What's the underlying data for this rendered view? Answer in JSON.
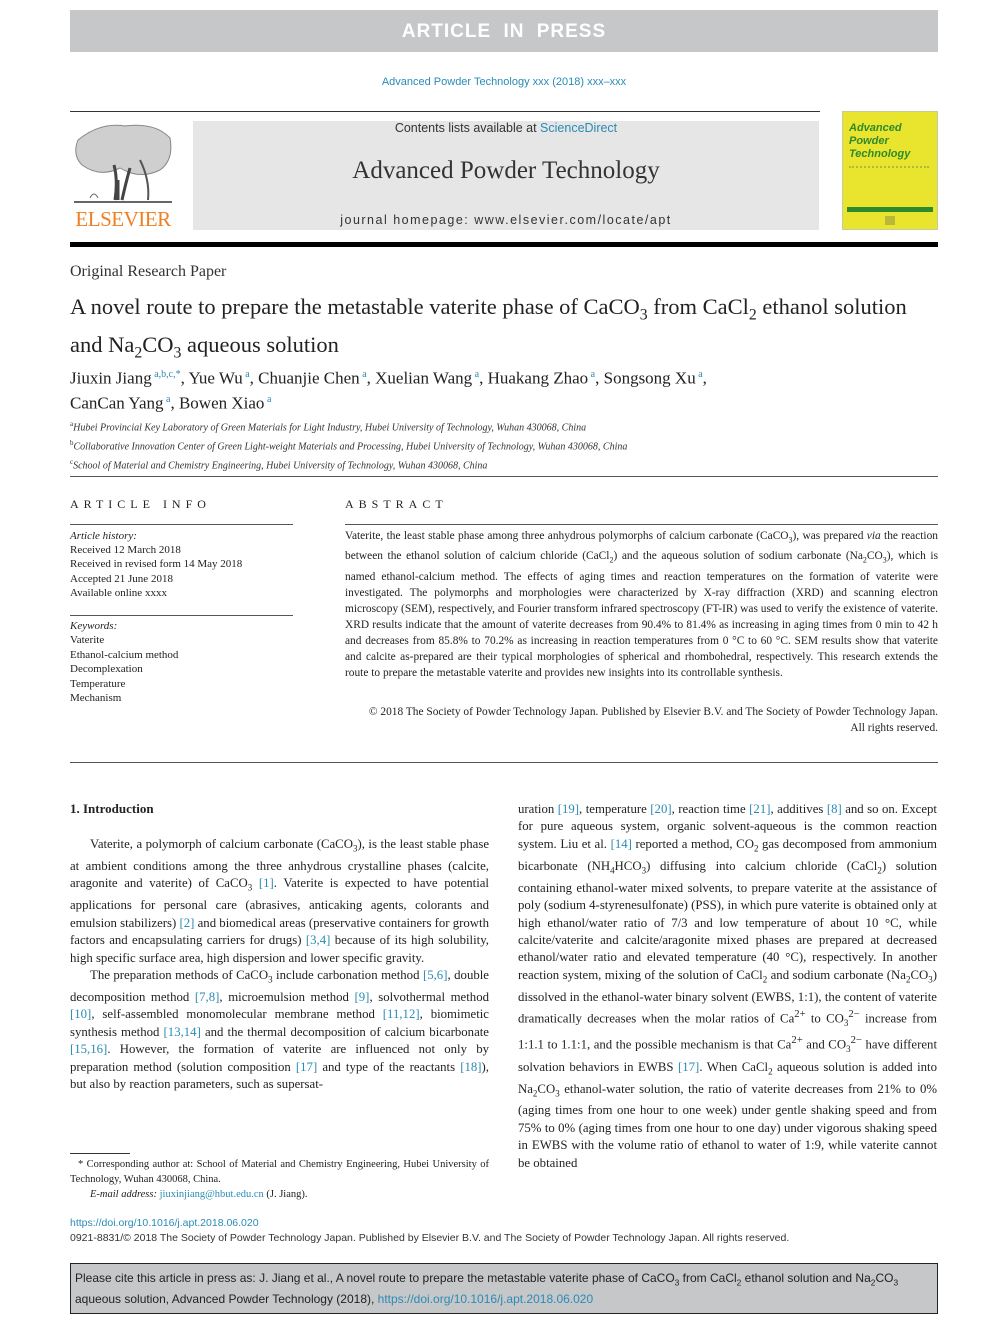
{
  "banner": "ARTICLE IN PRESS",
  "journal_citation": "Advanced Powder Technology xxx (2018) xxx–xxx",
  "header": {
    "publisher_logo_text": "ELSEVIER",
    "contents_prefix": "Contents lists available at ",
    "contents_link": "ScienceDirect",
    "journal_title": "Advanced Powder Technology",
    "homepage": "journal homepage: www.elsevier.com/locate/apt",
    "cover_title": "Advanced Powder Technology"
  },
  "article": {
    "type": "Original Research Paper",
    "title_html": "A novel route to prepare the metastable vaterite phase of CaCO<sub>3</sub> from CaCl<sub>2</sub> ethanol solution and Na<sub>2</sub>CO<sub>3</sub> aqueous solution",
    "authors": [
      {
        "name": "Jiuxin Jiang",
        "marks": "a,b,c,*"
      },
      {
        "name": "Yue Wu",
        "marks": "a"
      },
      {
        "name": "Chuanjie Chen",
        "marks": "a"
      },
      {
        "name": "Xuelian Wang",
        "marks": "a"
      },
      {
        "name": "Huakang Zhao",
        "marks": "a"
      },
      {
        "name": "Songsong Xu",
        "marks": "a"
      },
      {
        "name": "CanCan Yang",
        "marks": "a"
      },
      {
        "name": "Bowen Xiao",
        "marks": "a"
      }
    ],
    "affiliations": [
      {
        "mark": "a",
        "text": "Hubei Provincial Key Laboratory of Green Materials for Light Industry, Hubei University of Technology, Wuhan 430068, China"
      },
      {
        "mark": "b",
        "text": "Collaborative Innovation Center of Green Light-weight Materials and Processing, Hubei University of Technology, Wuhan 430068, China"
      },
      {
        "mark": "c",
        "text": "School of Material and Chemistry Engineering, Hubei University of Technology, Wuhan 430068, China"
      }
    ]
  },
  "article_info": {
    "heading": "ARTICLE INFO",
    "history_label": "Article history:",
    "history": [
      "Received 12 March 2018",
      "Received in revised form 14 May 2018",
      "Accepted 21 June 2018",
      "Available online xxxx"
    ],
    "keywords_label": "Keywords:",
    "keywords": [
      "Vaterite",
      "Ethanol-calcium method",
      "Decomplexation",
      "Temperature",
      "Mechanism"
    ]
  },
  "abstract": {
    "heading": "ABSTRACT",
    "text_html": "Vaterite, the least stable phase among three anhydrous polymorphs of calcium carbonate (CaCO<sub>3</sub>), was prepared <i>via</i> the reaction between the ethanol solution of calcium chloride (CaCl<sub>2</sub>) and the aqueous solution of sodium carbonate (Na<sub>2</sub>CO<sub>3</sub>), which is named ethanol-calcium method. The effects of aging times and reaction temperatures on the formation of vaterite were investigated. The polymorphs and morphologies were characterized by X-ray diffraction (XRD) and scanning electron microscopy (SEM), respectively, and Fourier transform infrared spectroscopy (FT-IR) was used to verify the existence of vaterite. XRD results indicate that the amount of vaterite decreases from 90.4% to 81.4% as increasing in aging times from 0 min to 42 h and decreases from 85.8% to 70.2% as increasing in reaction temperatures from 0 °C to 60 °C. SEM results show that vaterite and calcite as-prepared are their typical morphologies of spherical and rhombohedral, respectively. This research extends the route to prepare the metastable vaterite and provides new insights into its controllable synthesis.",
    "copyright": "© 2018 The Society of Powder Technology Japan. Published by Elsevier B.V. and The Society of Powder Technology Japan. All rights reserved."
  },
  "body": {
    "section_heading": "1. Introduction",
    "left_paragraphs_html": [
      "Vaterite, a polymorph of calcium carbonate (CaCO<sub>3</sub>), is the least stable phase at ambient conditions among the three anhydrous crystalline phases (calcite, aragonite and vaterite) of CaCO<sub>3</sub> <span class=\"link\">[1]</span>. Vaterite is expected to have potential applications for personal care (abrasives, anticaking agents, colorants and emulsion stabilizers) <span class=\"link\">[2]</span> and biomedical areas (preservative containers for growth factors and encapsulating carriers for drugs) <span class=\"link\">[3,4]</span> because of its high solubility, high specific surface area, high dispersion and lower specific gravity.",
      "The preparation methods of CaCO<sub>3</sub> include carbonation method <span class=\"link\">[5,6]</span>, double decomposition method <span class=\"link\">[7,8]</span>, microemulsion method <span class=\"link\">[9]</span>, solvothermal method <span class=\"link\">[10]</span>, self-assembled monomolecular membrane method <span class=\"link\">[11,12]</span>, biomimetic synthesis method <span class=\"link\">[13,14]</span> and the thermal decomposition of calcium bicarbonate <span class=\"link\">[15,16]</span>. However, the formation of vaterite are influenced not only by preparation method (solution composition <span class=\"link\">[17]</span> and type of the reactants <span class=\"link\">[18]</span>), but also by reaction parameters, such as supersat-"
    ],
    "right_paragraph_html": "uration <span class=\"link\">[19]</span>, temperature <span class=\"link\">[20]</span>, reaction time <span class=\"link\">[21]</span>, additives <span class=\"link\">[8]</span> and so on. Except for pure aqueous system, organic solvent-aqueous is the common reaction system. Liu et al. <span class=\"link\">[14]</span> reported a method, CO<sub>2</sub> gas decomposed from ammonium bicarbonate (NH<sub>4</sub>HCO<sub>3</sub>) diffusing into calcium chloride (CaCl<sub>2</sub>) solution containing ethanol-water mixed solvents, to prepare vaterite at the assistance of poly (sodium 4-styrenesulfonate) (PSS), in which pure vaterite is obtained only at high ethanol/water ratio of 7/3 and low temperature of about 10 °C, while calcite/vaterite and calcite/aragonite mixed phases are prepared at decreased ethanol/water ratio and elevated temperature (40 °C), respectively. In another reaction system, mixing of the solution of CaCl<sub>2</sub> and sodium carbonate (Na<sub>2</sub>CO<sub>3</sub>) dissolved in the ethanol-water binary solvent (EWBS, 1:1), the content of vaterite dramatically decreases when the molar ratios of Ca<sup>2+</sup> to CO<sub>3</sub><sup>2−</sup> increase from 1:1.1 to 1.1:1, and the possible mechanism is that Ca<sup>2+</sup> and CO<sub>3</sub><sup>2−</sup> have different solvation behaviors in EWBS <span class=\"link\">[17]</span>. When CaCl<sub>2</sub> aqueous solution is added into Na<sub>2</sub>CO<sub>3</sub> ethanol-water solution, the ratio of vaterite decreases from 21% to 0% (aging times from one hour to one week) under gentle shaking speed and from 75% to 0% (aging times from one hour to one day) under vigorous shaking speed in EWBS with the volume ratio of ethanol to water of 1:9, while vaterite cannot be obtained"
  },
  "footnote": {
    "corresponding": "* Corresponding author at: School of Material and Chemistry Engineering, Hubei University of Technology, Wuhan 430068, China.",
    "email_label": "E-mail address: ",
    "email": "jiuxinjiang@hbut.edu.cn",
    "email_suffix": " (J. Jiang)."
  },
  "doi": {
    "link": "https://doi.org/10.1016/j.apt.2018.06.020",
    "issn_line": "0921-8831/© 2018 The Society of Powder Technology Japan. Published by Elsevier B.V. and The Society of Powder Technology Japan. All rights reserved."
  },
  "cite_box": {
    "text_html": "Please cite this article in press as: J. Jiang et al., A novel route to prepare the metastable vaterite phase of CaCO<sub>3</sub> from CaCl<sub>2</sub> ethanol solution and Na<sub>2</sub>CO<sub>3</sub> aqueous solution, Advanced Powder Technology (2018), ",
    "link": "https://doi.org/10.1016/j.apt.2018.06.020"
  }
}
